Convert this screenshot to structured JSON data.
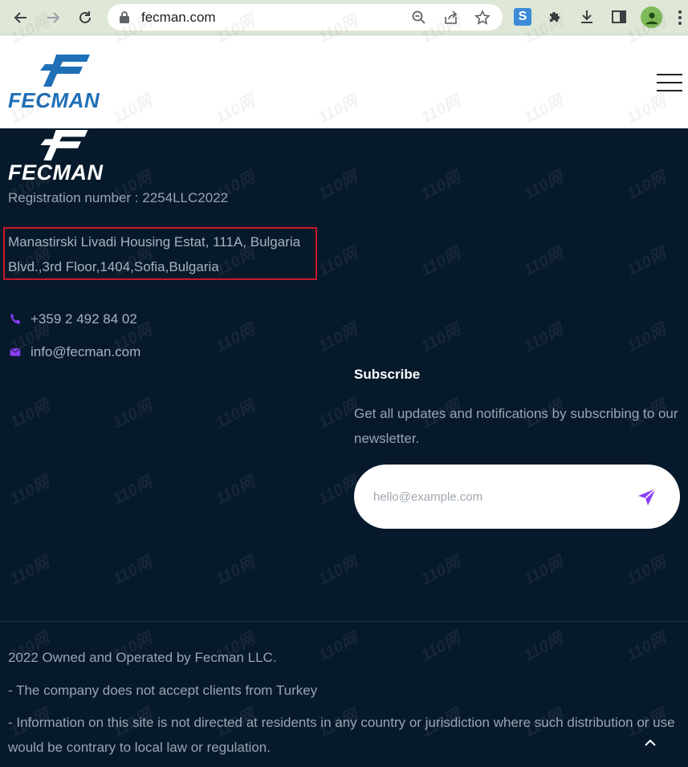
{
  "browser": {
    "url": "fecman.com"
  },
  "site": {
    "logo_text": "FECMAN"
  },
  "footer": {
    "logo_text": "FECMAN",
    "registration": "Registration number : 2254LLC2022",
    "address_line1": "Manastirski Livadi Housing Estat, 111A, Bulgaria",
    "address_line2": "Blvd.,3rd Floor,1404,Sofia,Bulgaria",
    "phone": "+359 2 492 84 02",
    "email": "info@fecman.com",
    "subscribe": {
      "title": "Subscribe",
      "text": "Get all updates and notifications by subscribing to our newsletter.",
      "placeholder": "hello@example.com"
    },
    "legal": {
      "copyright": "2022 Owned and Operated by Fecman LLC.",
      "note1": "- The company does not accept clients from Turkey",
      "note2": "- Information on this site is not directed at residents in any country or jurisdiction where such distribution or use would be contrary to local law or regulation."
    }
  },
  "colors": {
    "footer_bg": "#071a2c",
    "brand_blue": "#1f6fb7",
    "accent_purple": "#8b3cf7",
    "highlight_red": "#c8182a"
  },
  "watermark": "110网"
}
